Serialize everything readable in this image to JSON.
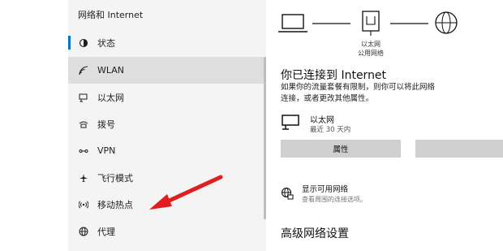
{
  "sidebar": {
    "title": "网络和 Internet",
    "items": [
      {
        "label": "状态",
        "icon": "home-status-icon"
      },
      {
        "label": "WLAN",
        "icon": "wifi-icon"
      },
      {
        "label": "以太网",
        "icon": "ethernet-icon"
      },
      {
        "label": "拨号",
        "icon": "dialup-icon"
      },
      {
        "label": "VPN",
        "icon": "vpn-icon"
      },
      {
        "label": "飞行模式",
        "icon": "airplane-icon"
      },
      {
        "label": "移动热点",
        "icon": "hotspot-icon"
      },
      {
        "label": "代理",
        "icon": "globe-icon"
      }
    ]
  },
  "topology": {
    "network_label": "以太网",
    "network_sub": "公用网络"
  },
  "status": {
    "heading": "你已连接到 Internet",
    "desc_line1": "如果你的流量套餐有限制，则你可以将此网络",
    "desc_line2": "连接，或者更改其他属性。",
    "connection_name": "以太网",
    "connection_sub": "最近 30 天内",
    "properties_button": "属性"
  },
  "show_networks": {
    "title": "显示可用网络",
    "sub": "查看周围的连接选项。"
  },
  "advanced_heading": "高级网络设置",
  "colors": {
    "accent": "#0a73c9",
    "arrow": "#e01e1e",
    "selected": "#dedede"
  }
}
